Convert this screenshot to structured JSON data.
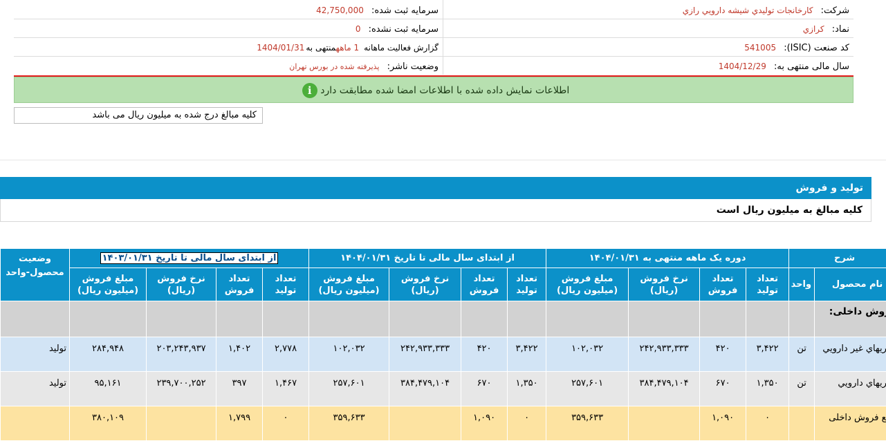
{
  "info": {
    "company_label": "شرکت:",
    "company_value": "کارخانجات توليدي شيشه دارويي رازي",
    "registered_capital_label": "سرمايه ثبت شده:",
    "registered_capital_value": "42,750,000",
    "symbol_label": "نماد:",
    "symbol_value": "کرازي",
    "unregistered_capital_label": "سرمايه ثبت نشده:",
    "unregistered_capital_value": "0",
    "isic_label": "کد صنعت (ISIC):",
    "isic_value": "541005",
    "report_label_prefix": "گزارش فعاليت ماهانه",
    "report_months": "1 ماهه",
    "report_label_mid": "منتهی به",
    "report_date": "1404/01/31",
    "fiscal_label": "سال مالی منتهی به:",
    "fiscal_value": "1404/12/29",
    "publisher_label": "وضعيت ناشر:",
    "publisher_value": "پذيرفته شده در بورس تهران"
  },
  "notice": {
    "text": "اطلاعات نمایش داده شده با اطلاعات امضا شده مطابقت دارد",
    "icon": "info-icon",
    "icon_glyph": "i"
  },
  "unit_note": "کلیه مبالغ درج شده به میلیون ریال می باشد",
  "section": {
    "title": "تولید و فروش",
    "note": "کلیه مبالغ به میلیون ریال است"
  },
  "table": {
    "groups": {
      "description": "شرح",
      "period_month": "دوره یک ماهه منتهی به ۱۴۰۴/۰۱/۳۱",
      "ytd_current": "از ابتدای سال مالی تا تاریخ ۱۴۰۴/۰۱/۳۱",
      "ytd_previous": "از ابتدای سال مالی تا تاریخ ۱۴۰۳/۰۱/۳۱",
      "status": "وضعیت محصول-واحد"
    },
    "columns": {
      "product_name": "نام محصول",
      "unit": "واحد",
      "production_count": "تعداد تولید",
      "sales_count": "تعداد فروش",
      "sales_rate": "نرخ فروش (ریال)",
      "sales_amount": "مبلغ فروش (میلیون ریال)"
    },
    "group_row": "فروش داخلی:",
    "rows": [
      {
        "product": "بطريهاي غير دارويي",
        "unit": "تن",
        "m_prod": "۳,۴۲۲",
        "m_sales": "۴۲۰",
        "m_rate": "۲۴۲,۹۳۳,۳۳۳",
        "m_amount": "۱۰۲,۰۳۲",
        "c_prod": "۳,۴۲۲",
        "c_sales": "۴۲۰",
        "c_rate": "۲۴۲,۹۳۳,۳۳۳",
        "c_amount": "۱۰۲,۰۳۲",
        "p_prod": "۲,۷۷۸",
        "p_sales": "۱,۴۰۲",
        "p_rate": "۲۰۳,۲۴۳,۹۳۷",
        "p_amount": "۲۸۴,۹۴۸",
        "status": "تولید"
      },
      {
        "product": "بطريهاي دارويي",
        "unit": "تن",
        "m_prod": "۱,۳۵۰",
        "m_sales": "۶۷۰",
        "m_rate": "۳۸۴,۴۷۹,۱۰۴",
        "m_amount": "۲۵۷,۶۰۱",
        "c_prod": "۱,۳۵۰",
        "c_sales": "۶۷۰",
        "c_rate": "۳۸۴,۴۷۹,۱۰۴",
        "c_amount": "۲۵۷,۶۰۱",
        "p_prod": "۱,۴۶۷",
        "p_sales": "۳۹۷",
        "p_rate": "۲۳۹,۷۰۰,۲۵۲",
        "p_amount": "۹۵,۱۶۱",
        "status": "تولید"
      }
    ],
    "total": {
      "label": "جمع فروش داخلی",
      "m_prod": "۰",
      "m_sales": "۱,۰۹۰",
      "m_amount": "۳۵۹,۶۳۳",
      "c_prod": "۰",
      "c_sales": "۱,۰۹۰",
      "c_amount": "۳۵۹,۶۳۳",
      "p_prod": "۰",
      "p_sales": "۱,۷۹۹",
      "p_amount": "۳۸۰,۱۰۹"
    }
  }
}
